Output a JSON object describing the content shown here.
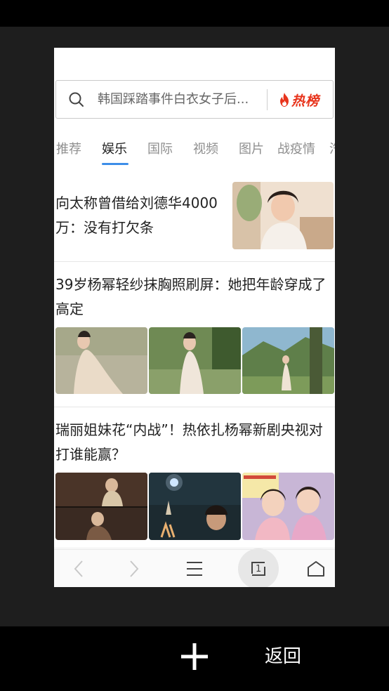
{
  "search": {
    "query": "韩国踩踏事件白衣女子后...",
    "hot_label": "热榜"
  },
  "tabs": [
    {
      "label": "推荐"
    },
    {
      "label": "娱乐"
    },
    {
      "label": "国际"
    },
    {
      "label": "视频"
    },
    {
      "label": "图片"
    },
    {
      "label": "战疫情"
    },
    {
      "label": "汽"
    }
  ],
  "news": [
    {
      "title_lines": [
        "向太称曾借给刘德华4000",
        "万：没有打欠条"
      ]
    },
    {
      "title_lines": [
        "39岁杨幂轻纱抹胸照刷屏：她把年龄穿成了",
        "高定"
      ]
    },
    {
      "title_lines": [
        "瑞丽姐妹花“内战”！热依扎杨幂新剧央视对",
        "打谁能赢？"
      ]
    }
  ],
  "bottom_nav": {
    "tab_count": "1"
  },
  "bottom_bar": {
    "back_label": "返回"
  },
  "colors": {
    "accent_blue": "#3d8ee8",
    "hot_red": "#e8341c"
  }
}
